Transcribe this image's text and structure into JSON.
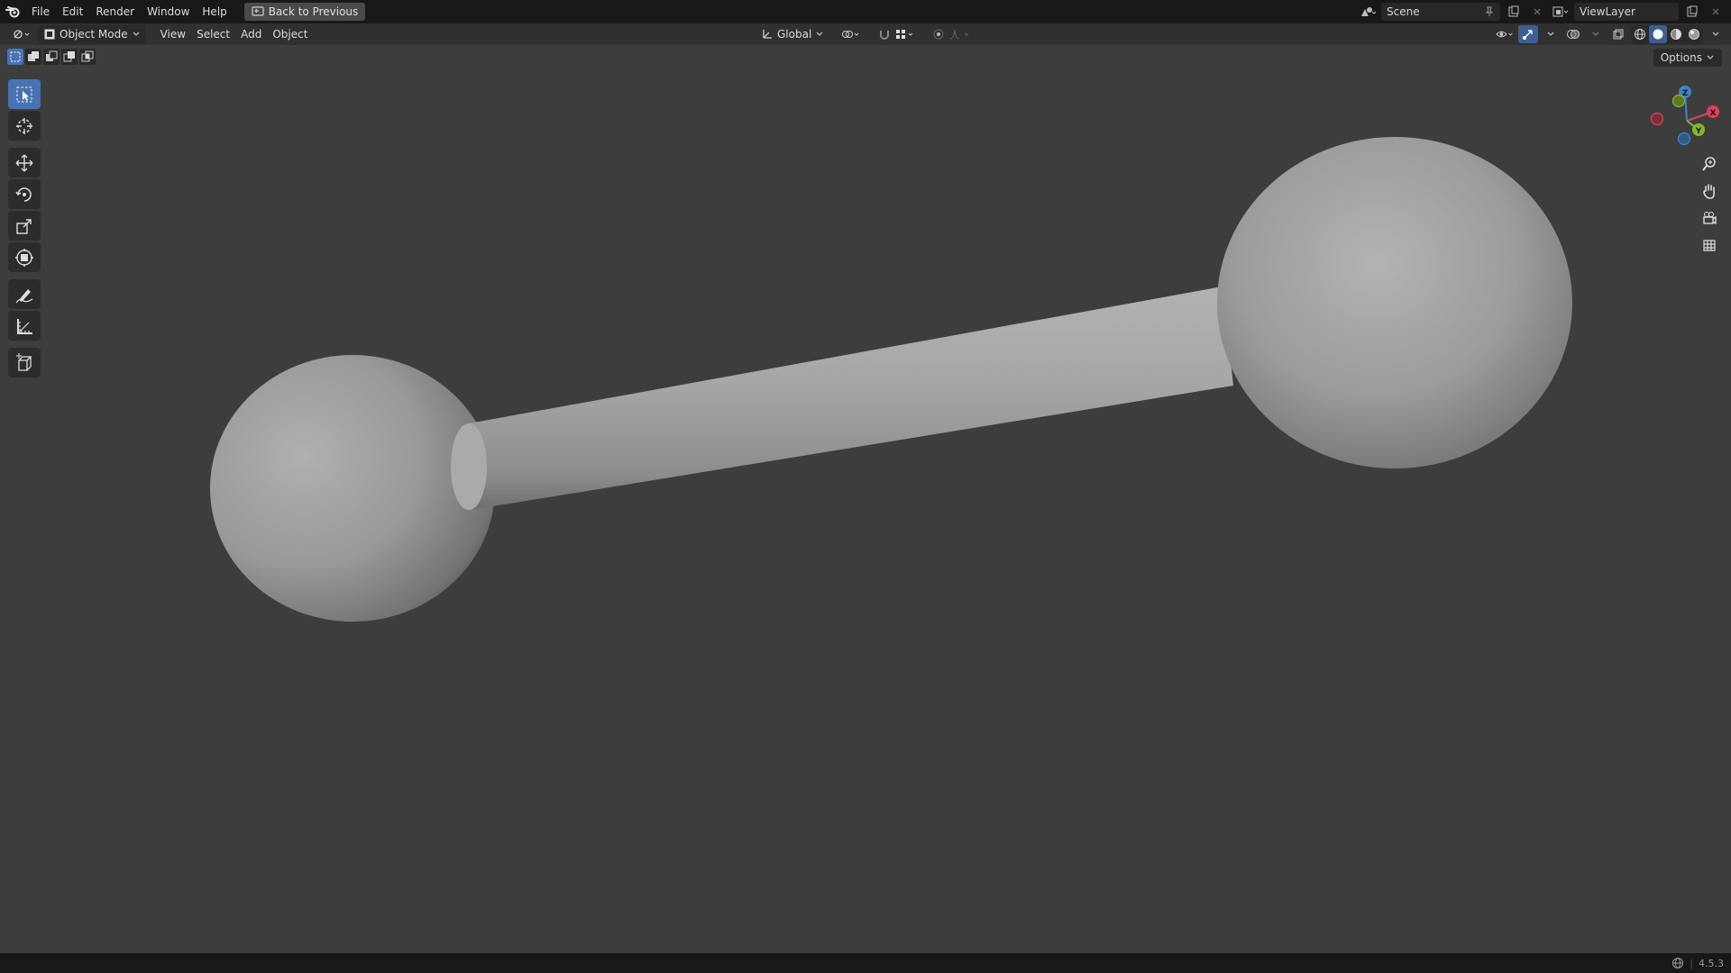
{
  "topbar": {
    "menu": [
      "File",
      "Edit",
      "Render",
      "Window",
      "Help"
    ],
    "back_label": "Back to Previous",
    "scene_name": "Scene",
    "viewlayer_name": "ViewLayer"
  },
  "header": {
    "mode": "Object Mode",
    "menus": [
      "View",
      "Select",
      "Add",
      "Object"
    ],
    "transform_orientation": "Global",
    "options_label": "Options"
  },
  "gizmo": {
    "x": "X",
    "y": "Y",
    "z": "Z"
  },
  "status": {
    "version": "4.5.3"
  },
  "colors": {
    "accent": "#4772b3",
    "x_axis": "#e0405a",
    "y_axis": "#86b52a",
    "z_axis": "#3f83c9"
  }
}
